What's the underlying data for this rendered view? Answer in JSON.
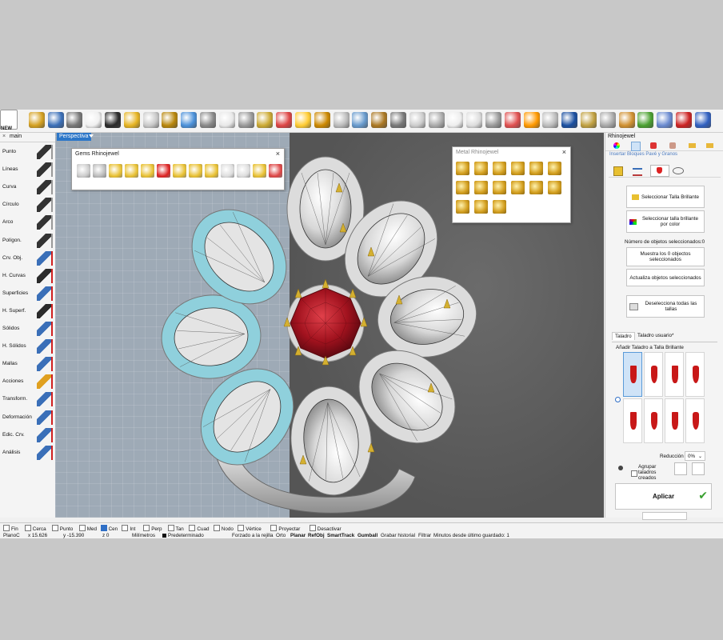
{
  "toolbar": {
    "new_label": "NEW",
    "icons": [
      "new-icon",
      "open-icon",
      "save-icon",
      "save-small-icon",
      "pointer-icon",
      "ring-icon",
      "gold-ring-icon",
      "sphere-icon",
      "gem-grid-icon",
      "undo-icon",
      "redo-icon",
      "document-icon",
      "copy-icon",
      "zoom-window-icon",
      "zoom-selected-icon",
      "grid-icon",
      "capsule-icon",
      "gold-band-icon",
      "bezel-icon",
      "prongs-icon",
      "plane-icon",
      "curve-icon",
      "dimension-icon",
      "light-bulb-icon",
      "lock-icon",
      "unlock-icon",
      "eraser-icon",
      "color-wheel-icon",
      "sphere-wire-icon",
      "blue-sphere-icon",
      "points-icon",
      "ruler-icon",
      "gear-icon",
      "render-icon",
      "cube-icon",
      "seven-icon",
      "help-icon"
    ],
    "colors": [
      "#cc2233",
      "#d4a020",
      "#3a6fb8",
      "#777777",
      "#f0f0f0",
      "#2a2a2a",
      "#e6b422",
      "#c8c8c8",
      "#b8860b",
      "#4a90d9",
      "#888888",
      "#e8e8e8",
      "#999999",
      "#ccaa33",
      "#dd4444",
      "#ffcc33",
      "#cc8800",
      "#bbbbbb",
      "#6699cc",
      "#aa7722",
      "#777777",
      "#cccccc",
      "#aaaaaa",
      "#eeeeee",
      "#dddddd",
      "#999999",
      "#e05050",
      "#ff9900",
      "#bcbcbc",
      "#1a4fa0",
      "#c0a040",
      "#a8a8a8",
      "#d09030",
      "#4aa030",
      "#6a8ad0",
      "#cc2222",
      "#3060c0"
    ]
  },
  "left_panel": {
    "tab_close": "×",
    "tab": "main",
    "items": [
      {
        "label": "Punto",
        "icon": "point-icon"
      },
      {
        "label": "Líneas",
        "icon": "lines-icon"
      },
      {
        "label": "Curva",
        "icon": "curve-icon"
      },
      {
        "label": "Círculo",
        "icon": "circle-icon"
      },
      {
        "label": "Arco",
        "icon": "arc-icon"
      },
      {
        "label": "Polígon.",
        "icon": "polygon-icon"
      },
      {
        "label": "Crv. Obj.",
        "icon": "curve-object-icon"
      },
      {
        "label": "H. Curvas",
        "icon": "curve-tools-icon"
      },
      {
        "label": "Superficies",
        "icon": "surface-icon"
      },
      {
        "label": "H. Superf.",
        "icon": "surface-tools-icon"
      },
      {
        "label": "Sólidos",
        "icon": "solid-icon"
      },
      {
        "label": "H. Sólidos",
        "icon": "solid-tools-icon"
      },
      {
        "label": "Mallas",
        "icon": "mesh-icon"
      },
      {
        "label": "Acciones",
        "icon": "actions-icon"
      },
      {
        "label": "Transform.",
        "icon": "transform-icon"
      },
      {
        "label": "Deformación",
        "icon": "deform-icon"
      },
      {
        "label": "Edic. Crv.",
        "icon": "curve-edit-icon"
      },
      {
        "label": "Análisis",
        "icon": "analysis-icon"
      }
    ]
  },
  "viewport": {
    "label": "Perspectiva"
  },
  "gems_palette": {
    "title": "Gems Rhinojewel",
    "close": "×"
  },
  "metal_palette": {
    "title": "Metal Rhinojewel",
    "close": "×"
  },
  "right_panel": {
    "title": "Rhinojewel",
    "subtitle": "Insertar Bloques Pavé y Granos",
    "btn_select_brilliant": "Seleccionar Talla Brillante",
    "btn_select_color": "Seleccionar talla brillante por color",
    "selected_count_label": "Número de objetos seleccionados:0",
    "btn_show": "Muestra los 0 objectos seleccionados",
    "btn_update": "Actualiza objetos seleccionados",
    "btn_deselect": "Deselecciona todas las tallas",
    "tab_drill": "Taladro",
    "tab_user_drill": "Taladro usuario*",
    "add_drill_label": "Añadir Taladro a Talla Brillante",
    "reduction_label": "Reducción",
    "reduction_value": "0%",
    "group_label": "Agrupar taladros creados",
    "apply_label": "Aplicar"
  },
  "status": {
    "snaps": [
      {
        "label": "Fin",
        "on": false
      },
      {
        "label": "Cerca",
        "on": false
      },
      {
        "label": "Punto",
        "on": false
      },
      {
        "label": "Med",
        "on": false
      },
      {
        "label": "Cen",
        "on": true
      },
      {
        "label": "Int",
        "on": false
      },
      {
        "label": "Perp",
        "on": false
      },
      {
        "label": "Tan",
        "on": false
      },
      {
        "label": "Cuad",
        "on": false
      },
      {
        "label": "Nodo",
        "on": false
      },
      {
        "label": "Vértice",
        "on": false
      },
      {
        "label": "Proyectar",
        "on": false
      },
      {
        "label": "Desactivar",
        "on": false
      }
    ],
    "plane": "PlanoC",
    "x": "x 15.626",
    "y": "y -15.390",
    "z": "z 0",
    "units": "Milímetros",
    "layer": "Predeterminado",
    "grid_snap": "Forzado a la rejilla",
    "ortho": "Orto",
    "planar": "Planar",
    "refobj": "RefObj",
    "smarttrack": "SmartTrack",
    "gumball": "Gumball",
    "history": "Grabar historial",
    "filter": "Filtrar",
    "minutes": "Minutos desde último guardado: 1"
  }
}
